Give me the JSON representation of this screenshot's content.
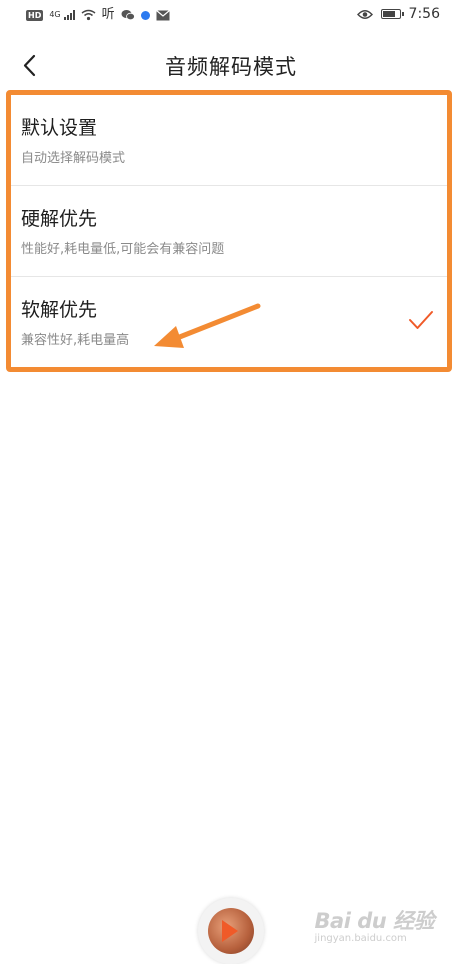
{
  "status_bar": {
    "hd_badge": "HD",
    "network_type": "4G",
    "listen_app": "听",
    "time": "7:56",
    "battery_level": 0.8,
    "app_dot_color": "#2d7bf0"
  },
  "header": {
    "title": "音频解码模式",
    "back_icon": "chevron-left-icon"
  },
  "options": [
    {
      "title": "默认设置",
      "subtitle": "自动选择解码模式",
      "selected": false
    },
    {
      "title": "硬解优先",
      "subtitle": "性能好,耗电量低,可能会有兼容问题",
      "selected": false
    },
    {
      "title": "软解优先",
      "subtitle": "兼容性好,耗电量高",
      "selected": true
    }
  ],
  "colors": {
    "accent": "#f05a28",
    "annotation": "#f38b33",
    "divider": "#e6e6e6"
  },
  "watermark": {
    "logo": "Bai du 经验",
    "url": "jingyan.baidu.com"
  }
}
